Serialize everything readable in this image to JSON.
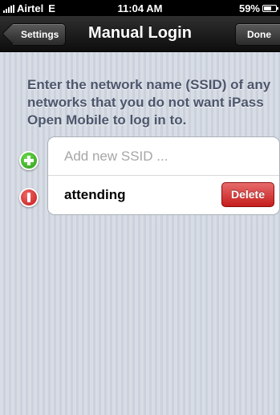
{
  "status_bar": {
    "carrier": "Airtel",
    "network": "E",
    "time": "11:04 AM",
    "battery": "59%",
    "battery_level": 0.59
  },
  "nav_bar": {
    "back_label": "Settings",
    "title": "Manual Login",
    "done_label": "Done"
  },
  "instructions": "Enter the network name (SSID) of any networks that you do not want iPass Open Mobile to log in to.",
  "ssid_list": {
    "add_placeholder": "Add new SSID ...",
    "items": [
      {
        "name": "attending",
        "delete_label": "Delete"
      }
    ]
  },
  "colors": {
    "accent_red": "#c51d1d",
    "add_green": "#2a9a1a",
    "instructions_text": "#4c566c"
  }
}
